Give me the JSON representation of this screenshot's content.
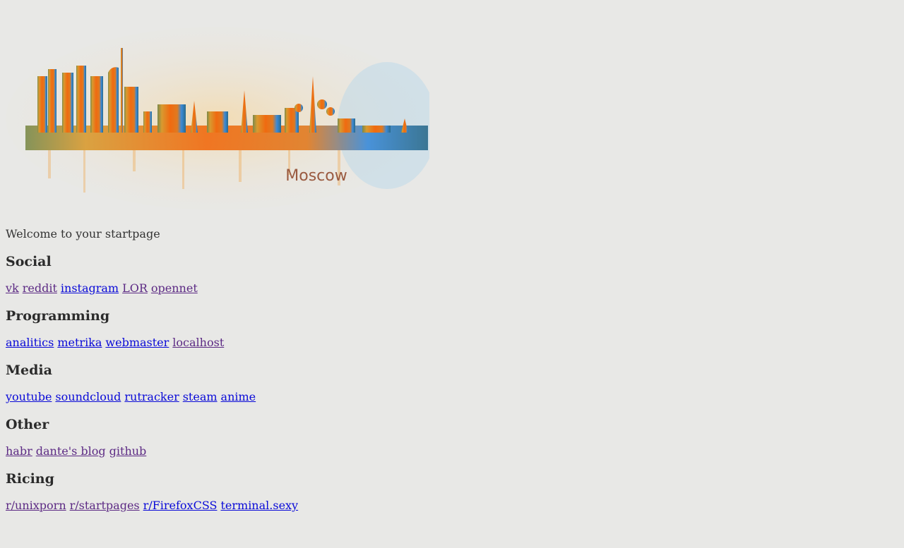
{
  "banner": {
    "caption": "Moscow"
  },
  "welcome": "Welcome to your startpage",
  "sections": [
    {
      "title": "Social",
      "links": [
        {
          "label": "vk",
          "visited": true
        },
        {
          "label": "reddit",
          "visited": true
        },
        {
          "label": "instagram",
          "visited": false
        },
        {
          "label": "LOR",
          "visited": true
        },
        {
          "label": "opennet",
          "visited": true
        }
      ]
    },
    {
      "title": "Programming",
      "links": [
        {
          "label": "analitics",
          "visited": false
        },
        {
          "label": "metrika",
          "visited": false
        },
        {
          "label": "webmaster",
          "visited": false
        },
        {
          "label": "localhost",
          "visited": true
        }
      ]
    },
    {
      "title": "Media",
      "links": [
        {
          "label": "youtube",
          "visited": false
        },
        {
          "label": "soundcloud",
          "visited": false
        },
        {
          "label": "rutracker",
          "visited": false
        },
        {
          "label": "steam",
          "visited": false
        },
        {
          "label": "anime",
          "visited": false
        }
      ]
    },
    {
      "title": "Other",
      "links": [
        {
          "label": "habr",
          "visited": true
        },
        {
          "label": "dante's blog",
          "visited": true
        },
        {
          "label": "github",
          "visited": true
        }
      ]
    },
    {
      "title": "Ricing",
      "links": [
        {
          "label": "r/unixporn",
          "visited": true
        },
        {
          "label": "r/startpages",
          "visited": true
        },
        {
          "label": "r/FirefoxCSS",
          "visited": false
        },
        {
          "label": "terminal.sexy",
          "visited": false
        }
      ]
    }
  ],
  "colors": {
    "link": "#0a0ad8",
    "visited": "#5c2a84",
    "background": "#e8e8e6",
    "text": "#333333"
  }
}
